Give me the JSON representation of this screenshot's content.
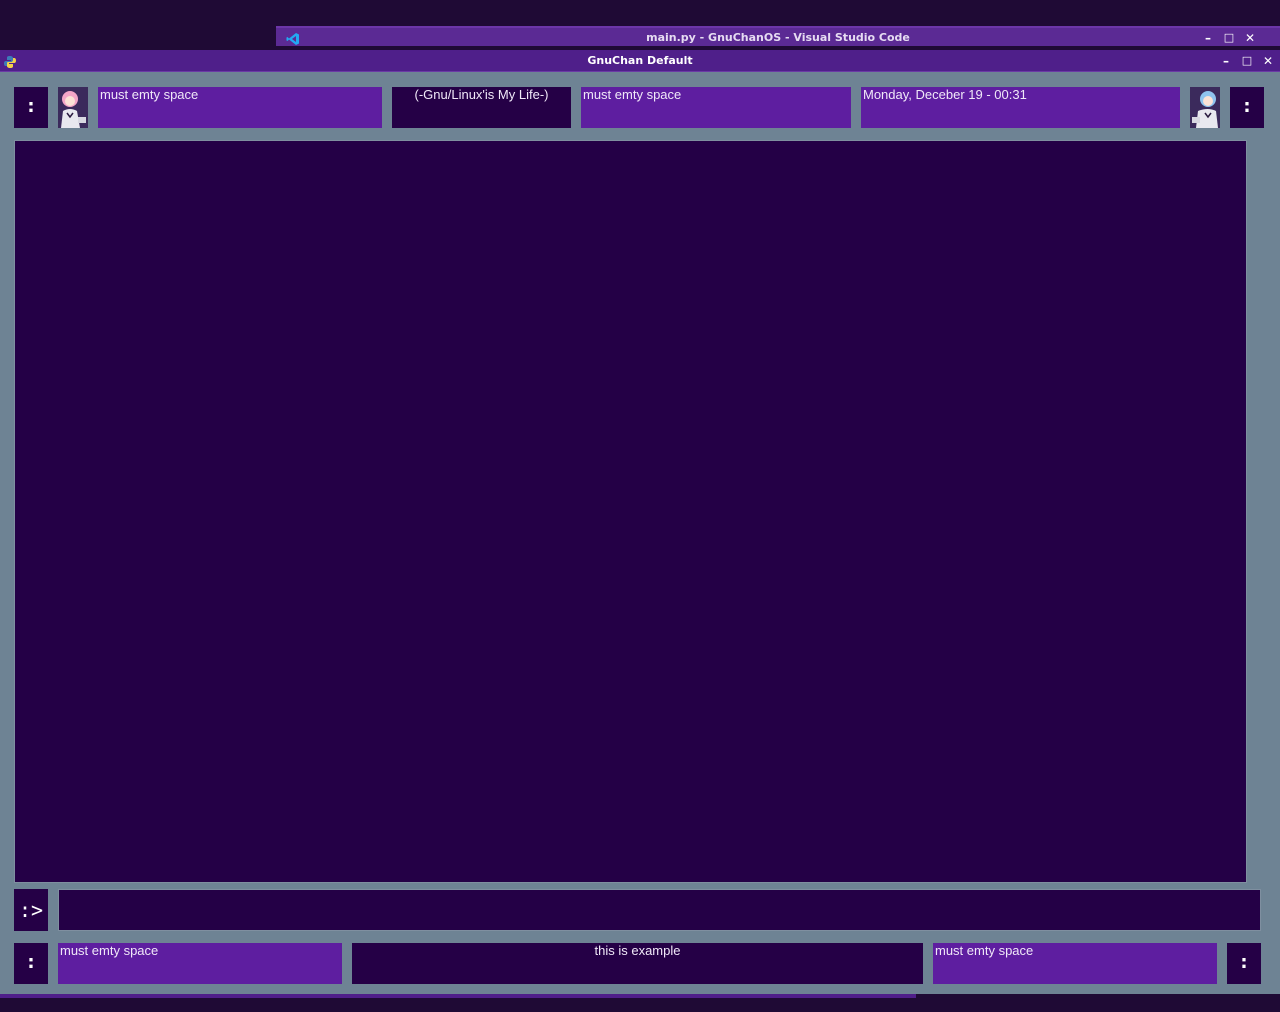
{
  "background_window": {
    "title": "main.py - GnuChanOS - Visual Studio Code",
    "icon": "vscode-icon",
    "buttons": [
      "–",
      "□",
      "✕"
    ]
  },
  "window": {
    "title": "GnuChan Default",
    "icon": "python-icon",
    "buttons": [
      "–",
      "□",
      "✕"
    ]
  },
  "top_bar": {
    "menu_left": ":",
    "avatar_left": "pink-hair-avatar-icon",
    "cell1": "must emty space",
    "cell2": "(-Gnu/Linux'is My Life-)",
    "cell3": "must emty space",
    "clock": "Monday, Deceber 19 - 00:31",
    "avatar_right": "blue-hair-avatar-icon",
    "menu_right": ":"
  },
  "command": {
    "prompt": ":>",
    "value": ""
  },
  "bottom_bar": {
    "menu_left": ":",
    "cell1": "must emty space",
    "cell2": "this is example",
    "cell3": "must emty space",
    "menu_right": ":"
  },
  "colors": {
    "accent_purple": "#5e1ea0",
    "dark_panel": "#250046",
    "frame": "#6e8394"
  }
}
